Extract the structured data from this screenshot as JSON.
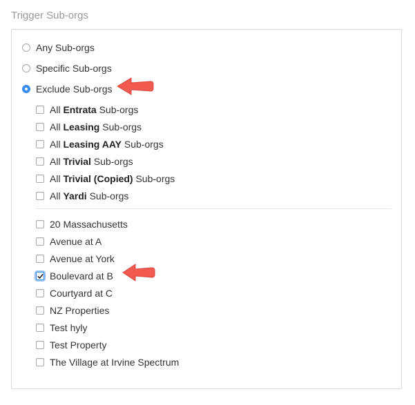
{
  "legend": "Trigger Sub-orgs",
  "accent_color": "#3b8df2",
  "arrow_color": "#f05a4f",
  "radios": [
    {
      "label": "Any Sub-orgs",
      "checked": false
    },
    {
      "label": "Specific Sub-orgs",
      "checked": false
    },
    {
      "label": "Exclude Sub-orgs",
      "checked": true
    }
  ],
  "group_options": [
    {
      "prefix": "All ",
      "bold": "Entrata",
      "suffix": " Sub-orgs",
      "checked": false
    },
    {
      "prefix": "All ",
      "bold": "Leasing",
      "suffix": " Sub-orgs",
      "checked": false
    },
    {
      "prefix": "All ",
      "bold": "Leasing AAY",
      "suffix": " Sub-orgs",
      "checked": false
    },
    {
      "prefix": "All ",
      "bold": "Trivial",
      "suffix": " Sub-orgs",
      "checked": false
    },
    {
      "prefix": "All ",
      "bold": "Trivial (Copied)",
      "suffix": " Sub-orgs",
      "checked": false
    },
    {
      "prefix": "All ",
      "bold": "Yardi",
      "suffix": " Sub-orgs",
      "checked": false
    }
  ],
  "suborgs": [
    {
      "label": "20 Massachusetts",
      "checked": false
    },
    {
      "label": "Avenue at A",
      "checked": false
    },
    {
      "label": "Avenue at York",
      "checked": false
    },
    {
      "label": "Boulevard at B",
      "checked": true
    },
    {
      "label": "Courtyard at C",
      "checked": false
    },
    {
      "label": "NZ Properties",
      "checked": false
    },
    {
      "label": "Test hyly",
      "checked": false
    },
    {
      "label": "Test Property",
      "checked": false
    },
    {
      "label": "The Village at Irvine Spectrum",
      "checked": false
    }
  ]
}
